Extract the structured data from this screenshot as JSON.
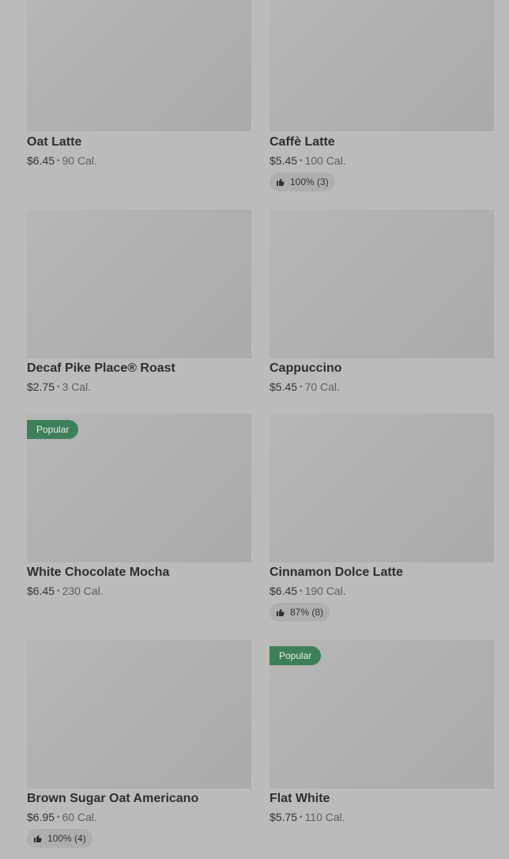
{
  "items": [
    {
      "name": "Oat Latte",
      "price": "$6.45",
      "calories": "90 Cal.",
      "badge": "",
      "rating": ""
    },
    {
      "name": "Caffè Latte",
      "price": "$5.45",
      "calories": "100 Cal.",
      "badge": "",
      "rating": "100% (3)"
    },
    {
      "name": "Decaf Pike Place® Roast",
      "price": "$2.75",
      "calories": "3 Cal.",
      "badge": "",
      "rating": ""
    },
    {
      "name": "Cappuccino",
      "price": "$5.45",
      "calories": "70 Cal.",
      "badge": "",
      "rating": ""
    },
    {
      "name": "White Chocolate Mocha",
      "price": "$6.45",
      "calories": "230 Cal.",
      "badge": "Popular",
      "rating": ""
    },
    {
      "name": "Cinnamon Dolce Latte",
      "price": "$6.45",
      "calories": "190 Cal.",
      "badge": "",
      "rating": "87% (8)"
    },
    {
      "name": "Brown Sugar Oat Americano",
      "price": "$6.95",
      "calories": "60 Cal.",
      "badge": "",
      "rating": "100% (4)"
    },
    {
      "name": "Flat White",
      "price": "$5.75",
      "calories": "110 Cal.",
      "badge": "Popular",
      "rating": ""
    }
  ],
  "colors": {
    "overlay": "#bbbbbb",
    "badge": "#3d7f59",
    "image_placeholder": "#b0b0b0"
  },
  "icons": {
    "rating": "thumbs-up-icon",
    "separator": "bullet-dot"
  }
}
